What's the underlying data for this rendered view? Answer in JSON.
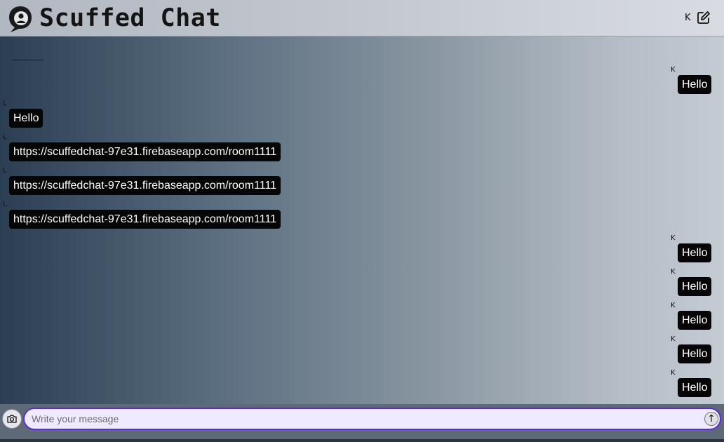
{
  "header": {
    "brand": "Scuffed Chat",
    "user_initial": "K"
  },
  "icons": {
    "logo": "chat-bubble-person-logo",
    "edit": "edit-square-icon",
    "camera": "camera-icon",
    "send": "up-arrow-icon"
  },
  "messages": [
    {
      "sender": "K",
      "text": "Hello",
      "side": "right"
    },
    {
      "sender": "L",
      "text": "Hello",
      "side": "left"
    },
    {
      "sender": "L",
      "text": "https://scuffedchat-97e31.firebaseapp.com/room1111",
      "side": "left"
    },
    {
      "sender": "L",
      "text": "https://scuffedchat-97e31.firebaseapp.com/room1111",
      "side": "left"
    },
    {
      "sender": "L",
      "text": "https://scuffedchat-97e31.firebaseapp.com/room1111",
      "side": "left"
    },
    {
      "sender": "K",
      "text": "Hello",
      "side": "right"
    },
    {
      "sender": "K",
      "text": "Hello",
      "side": "right"
    },
    {
      "sender": "K",
      "text": "Hello",
      "side": "right"
    },
    {
      "sender": "K",
      "text": "Hello",
      "side": "right"
    },
    {
      "sender": "K",
      "text": "Hello",
      "side": "right"
    }
  ],
  "composer": {
    "placeholder": "Write your message",
    "value": "",
    "send_symbol": "↑"
  },
  "colors": {
    "bubble": "#060606",
    "bubble_text": "#ffffff",
    "input_border": "#5a2fd0",
    "input_bg": "#efeaff"
  }
}
